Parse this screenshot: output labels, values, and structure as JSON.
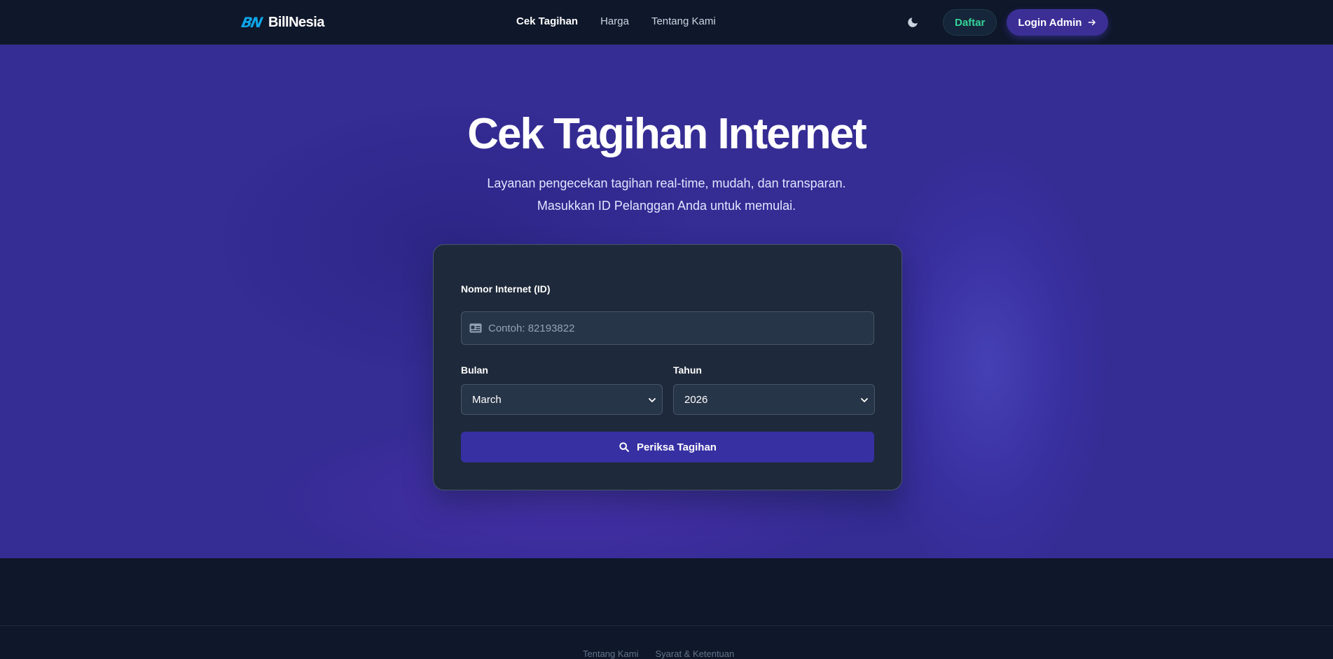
{
  "brand": {
    "logo_text": "BN",
    "name": "BillNesia"
  },
  "nav": {
    "links": [
      {
        "label": "Cek Tagihan"
      },
      {
        "label": "Harga"
      },
      {
        "label": "Tentang Kami"
      }
    ],
    "daftar_label": "Daftar",
    "login_label": "Login Admin"
  },
  "hero": {
    "title": "Cek Tagihan Internet",
    "subtitle_line1": "Layanan pengecekan tagihan real-time, mudah, dan transparan.",
    "subtitle_line2": "Masukkan ID Pelanggan Anda untuk memulai."
  },
  "form": {
    "id_label": "Nomor Internet (ID)",
    "id_value": "",
    "id_placeholder": "Contoh: 82193822",
    "month_label": "Bulan",
    "month_value": "March",
    "year_label": "Tahun",
    "year_value": "2026",
    "submit_label": "Periksa Tagihan"
  },
  "footer": {
    "links": [
      {
        "label": "Tentang Kami"
      },
      {
        "label": "Syarat & Ketentuan"
      }
    ]
  },
  "colors": {
    "background": "#0f172a",
    "hero": "#352c94",
    "card": "#1e293b",
    "primary_button": "#3730a3",
    "accent_green": "#34d399",
    "brand_blue": "#0ea5e9"
  }
}
